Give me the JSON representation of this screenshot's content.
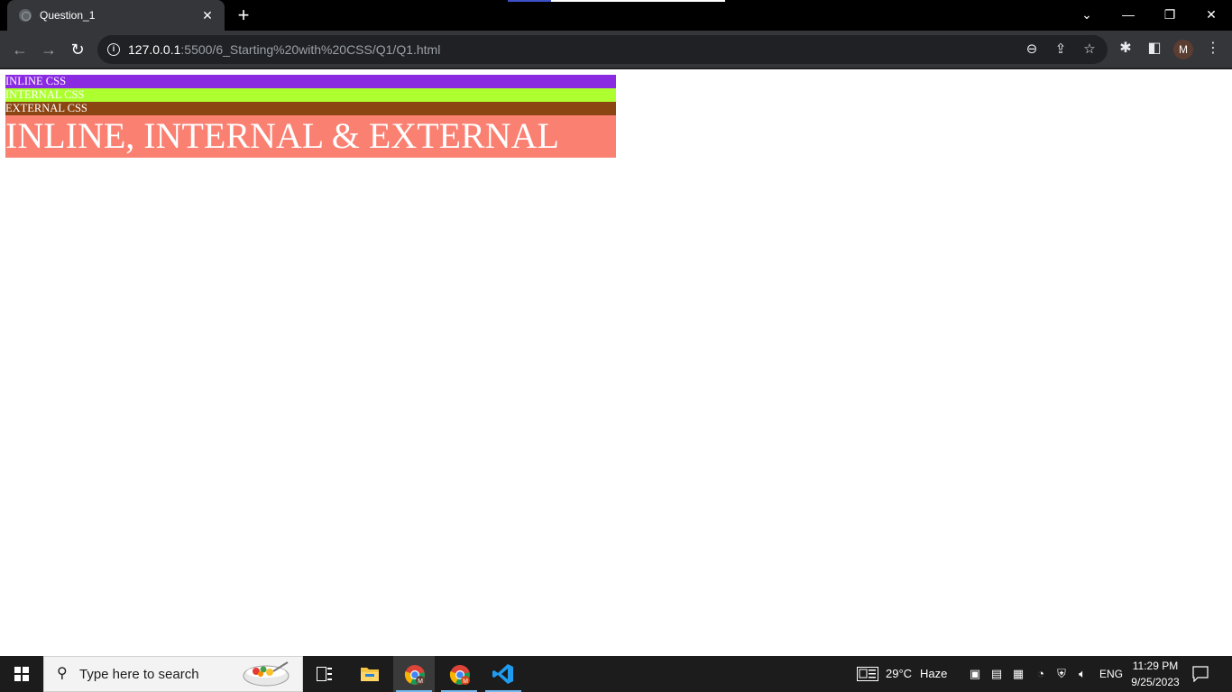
{
  "browser": {
    "tab": {
      "title": "Question_1",
      "close_glyph": "✕"
    },
    "new_tab_glyph": "+",
    "window_controls": {
      "tab_search_glyph": "⌄",
      "minimize_glyph": "—",
      "restore_glyph": "❐",
      "close_glyph": "✕"
    },
    "nav": {
      "back_glyph": "←",
      "forward_glyph": "→",
      "reload_glyph": "↻"
    },
    "omnibox": {
      "url_host": "127.0.0.1",
      "url_path": ":5500/6_Starting%20with%20CSS/Q1/Q1.html",
      "info_glyph": "i",
      "zoom_glyph": "⊖",
      "share_glyph": "⇪",
      "bookmark_glyph": "☆"
    },
    "toolbar": {
      "extensions_glyph": "✱",
      "side_panel_glyph": "◧",
      "profile_initial": "M",
      "menu_glyph": "⋮"
    }
  },
  "page": {
    "inline_label": "INLINE CSS",
    "internal_label": "INTERNAL CSS",
    "external_label": "EXTERNAL CSS",
    "heading": "INLINE, INTERNAL & EXTERNAL",
    "colors": {
      "inline_bg": "#8a2be2",
      "internal_bg": "#adff2f",
      "external_bg": "#8b4513",
      "heading_bg": "#fa8072"
    }
  },
  "taskbar": {
    "search_placeholder": "Type here to search",
    "search_glyph": "⚲",
    "weather": {
      "temperature": "29°C",
      "condition": "Haze"
    },
    "language": "ENG",
    "time": "11:29 PM",
    "date": "9/25/2023",
    "pinned_apps": [
      "task-view",
      "file-explorer",
      "chrome-profile",
      "chrome-profile-2",
      "visual-studio-code"
    ]
  }
}
